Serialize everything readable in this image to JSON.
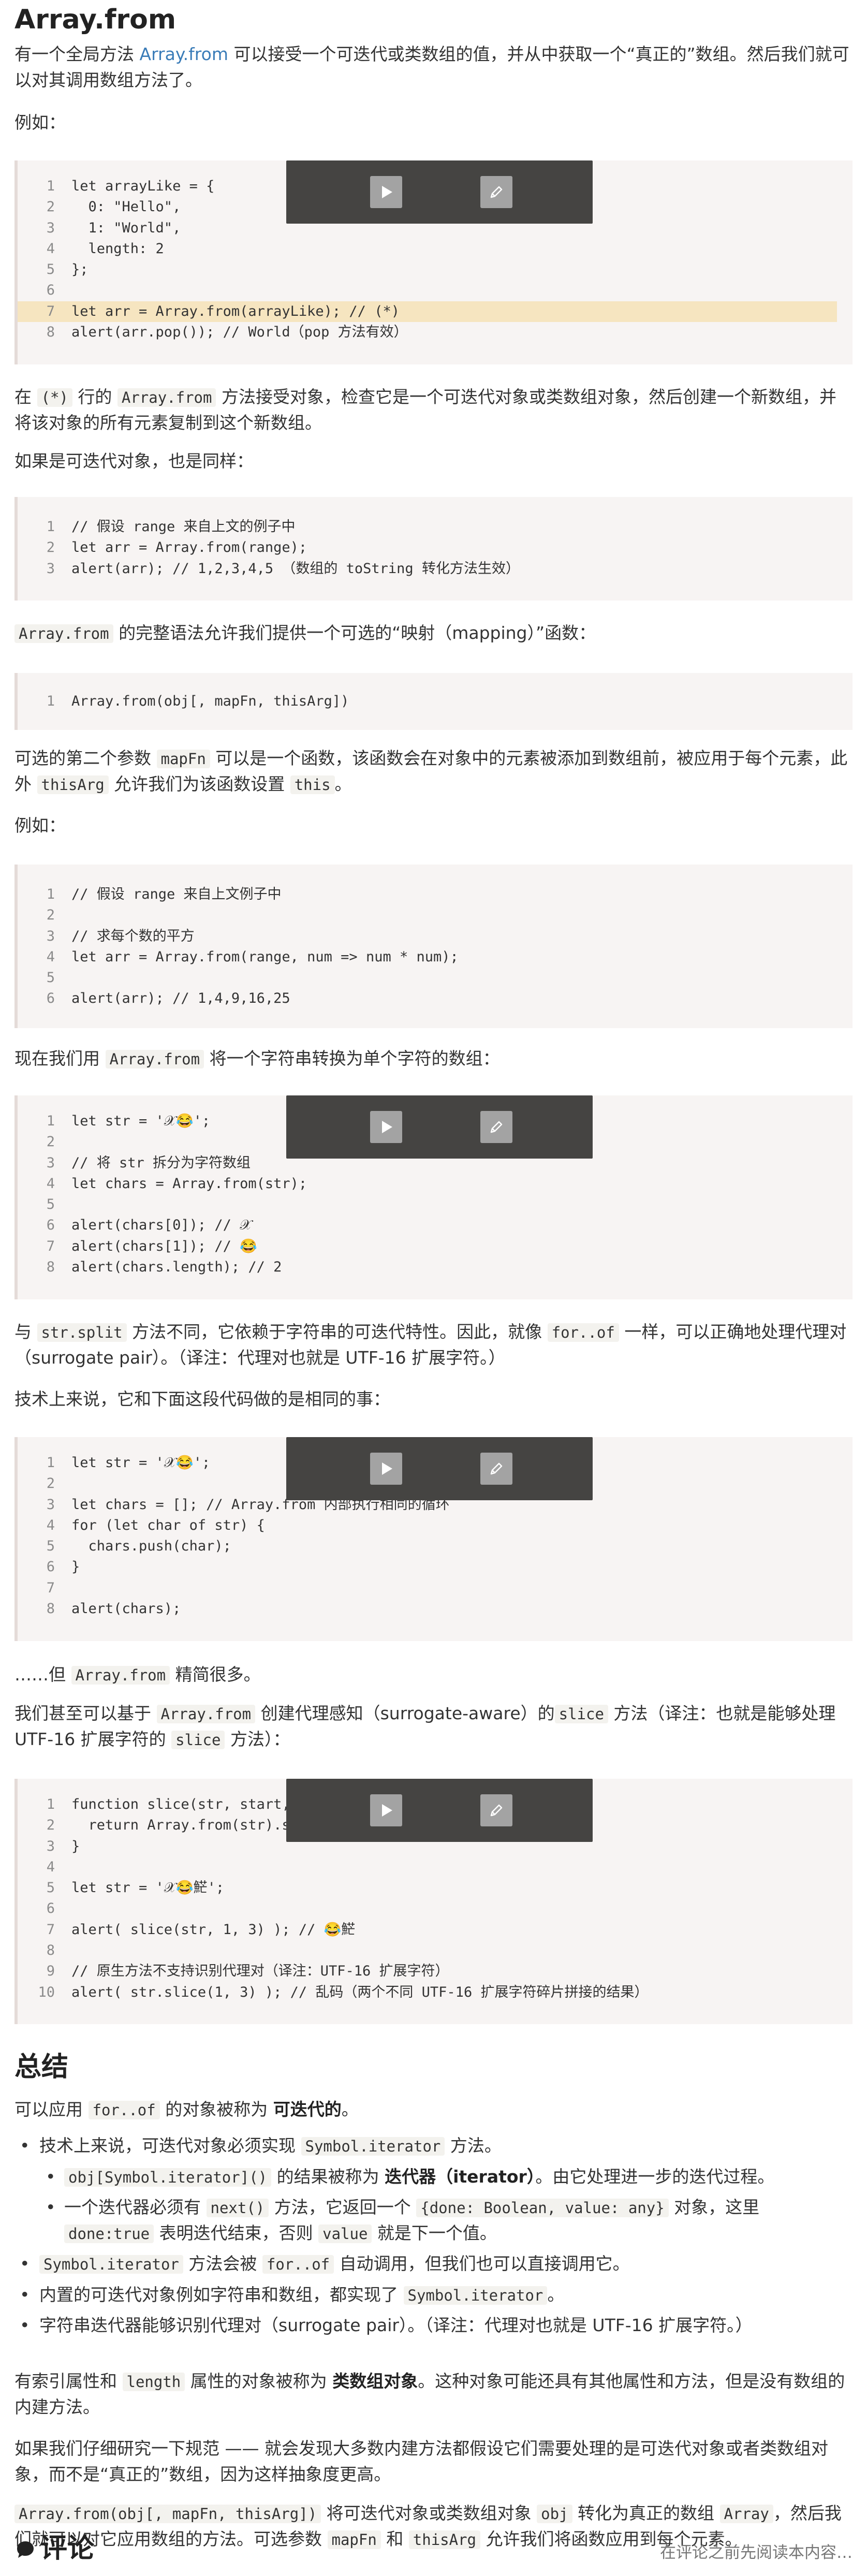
{
  "title": "Array.from",
  "intro": {
    "p1_a": "有一个全局方法 ",
    "p1_link": "Array.from",
    "p1_b": " 可以接受一个可迭代或类数组的值，并从中获取一个“真正的”数组。然后我们就可以对其调用数组方法了。",
    "example_label": "例如："
  },
  "block1": [
    [
      "1",
      "let arrayLike = {"
    ],
    [
      "2",
      "  0: \"Hello\","
    ],
    [
      "3",
      "  1: \"World\","
    ],
    [
      "4",
      "  length: 2"
    ],
    [
      "5",
      "};"
    ],
    [
      "6",
      ""
    ],
    [
      "7",
      "let arr = Array.from(arrayLike); // (*)"
    ],
    [
      "8",
      "alert(arr.pop()); // World（pop 方法有效）"
    ]
  ],
  "para2": {
    "a": "在 ",
    "code1": "(*)",
    "b": " 行的 ",
    "code2": "Array.from",
    "c": " 方法接受对象，检查它是一个可迭代对象或类数组对象，然后创建一个新数组，并将该对象的所有元素复制到这个新数组。"
  },
  "para3": "如果是可迭代对象，也是同样：",
  "block2": [
    [
      "1",
      "// 假设 range 来自上文的例子中"
    ],
    [
      "2",
      "let arr = Array.from(range);"
    ],
    [
      "3",
      "alert(arr); // 1,2,3,4,5 （数组的 toString 转化方法生效）"
    ]
  ],
  "para4": {
    "code": "Array.from",
    "text": " 的完整语法允许我们提供一个可选的“映射（mapping）”函数："
  },
  "block3": [
    [
      "1",
      "Array.from(obj[, mapFn, thisArg])"
    ]
  ],
  "para5": {
    "a": "可选的第二个参数 ",
    "code1": "mapFn",
    "b": " 可以是一个函数，该函数会在对象中的元素被添加到数组前，被应用于每个元素，此外 ",
    "code2": "thisArg",
    "c": " 允许我们为该函数设置 ",
    "code3": "this",
    "d": "。"
  },
  "para6": "例如：",
  "block4": [
    [
      "1",
      "// 假设 range 来自上文例子中"
    ],
    [
      "2",
      ""
    ],
    [
      "3",
      "// 求每个数的平方"
    ],
    [
      "4",
      "let arr = Array.from(range, num => num * num);"
    ],
    [
      "5",
      ""
    ],
    [
      "6",
      "alert(arr); // 1,4,9,16,25"
    ]
  ],
  "para7": {
    "a": "现在我们用 ",
    "code": "Array.from",
    "b": " 将一个字符串转换为单个字符的数组："
  },
  "block5": [
    [
      "1",
      "let str = '𝒳😂';"
    ],
    [
      "2",
      ""
    ],
    [
      "3",
      "// 将 str 拆分为字符数组"
    ],
    [
      "4",
      "let chars = Array.from(str);"
    ],
    [
      "5",
      ""
    ],
    [
      "6",
      "alert(chars[0]); // 𝒳"
    ],
    [
      "7",
      "alert(chars[1]); // 😂"
    ],
    [
      "8",
      "alert(chars.length); // 2"
    ]
  ],
  "para8": {
    "a": "与 ",
    "code1": "str.split",
    "b": " 方法不同，它依赖于字符串的可迭代特性。因此，就像 ",
    "code2": "for..of",
    "c": " 一样，可以正确地处理代理对（surrogate pair）。（译注：代理对也就是 UTF-16 扩展字符。）"
  },
  "para9": "技术上来说，它和下面这段代码做的是相同的事：",
  "block6": [
    [
      "1",
      "let str = '𝒳😂';"
    ],
    [
      "2",
      ""
    ],
    [
      "3",
      "let chars = []; // Array.from 内部执行相同的循环"
    ],
    [
      "4",
      "for (let char of str) {"
    ],
    [
      "5",
      "  chars.push(char);"
    ],
    [
      "6",
      "}"
    ],
    [
      "7",
      ""
    ],
    [
      "8",
      "alert(chars);"
    ]
  ],
  "para10": {
    "a": "……但 ",
    "code": "Array.from",
    "b": " 精简很多。"
  },
  "para11": {
    "a": "我们甚至可以基于 ",
    "code1": "Array.from",
    "b": " 创建代理感知（surrogate-aware）的",
    "code2": "slice",
    "c": " 方法（译注：也就是能够处理 UTF-16 扩展字符的 ",
    "code3": "slice",
    "d": " 方法）："
  },
  "block7": [
    [
      "1",
      "function slice(str, start, end) {"
    ],
    [
      "2",
      "  return Array.from(str).slice(start, end).join('');"
    ],
    [
      "3",
      "}"
    ],
    [
      "4",
      ""
    ],
    [
      "5",
      "let str = '𝒳😂𩷶';"
    ],
    [
      "6",
      ""
    ],
    [
      "7",
      "alert( slice(str, 1, 3) ); // 😂𩷶"
    ],
    [
      "8",
      ""
    ],
    [
      "9",
      "// 原生方法不支持识别代理对（译注：UTF-16 扩展字符）"
    ],
    [
      "10",
      "alert( str.slice(1, 3) ); // 乱码（两个不同 UTF-16 扩展字符碎片拼接的结果）"
    ]
  ],
  "summary": {
    "title": "总结",
    "p1_a": "可以应用 ",
    "p1_code": "for..of",
    "p1_b": " 的对象被称为 ",
    "p1_bold": "可迭代的",
    "p1_c": "。",
    "b1_a": "技术上来说，可迭代对象必须实现 ",
    "b1_code": "Symbol.iterator",
    "b1_b": " 方法。",
    "b1_1_code": "obj[Symbol.iterator]()",
    "b1_1_a": " 的结果被称为 ",
    "b1_1_bold": "迭代器（iterator）",
    "b1_1_b": "。由它处理进一步的迭代过程。",
    "b1_2_a": "一个迭代器必须有 ",
    "b1_2_code1": "next()",
    "b1_2_b": " 方法，它返回一个 ",
    "b1_2_code2": "{done: Boolean, value: any}",
    "b1_2_c": " 对象，这里 ",
    "b1_2_code3": "done:true",
    "b1_2_d": " 表明迭代结束，否则 ",
    "b1_2_code4": "value",
    "b1_2_e": " 就是下一个值。",
    "b2_code1": "Symbol.iterator",
    "b2_a": " 方法会被 ",
    "b2_code2": "for..of",
    "b2_b": " 自动调用，但我们也可以直接调用它。",
    "b3_a": "内置的可迭代对象例如字符串和数组，都实现了 ",
    "b3_code": "Symbol.iterator",
    "b3_b": "。",
    "b4": "字符串迭代器能够识别代理对（surrogate pair）。（译注：代理对也就是 UTF-16 扩展字符。）",
    "p2_a": "有索引属性和 ",
    "p2_code": "length",
    "p2_b": " 属性的对象被称为 ",
    "p2_bold": "类数组对象",
    "p2_c": "。这种对象可能还具有其他属性和方法，但是没有数组的内建方法。",
    "p3": "如果我们仔细研究一下规范 —— 就会发现大多数内建方法都假设它们需要处理的是可迭代对象或者类数组对象，而不是“真正的”数组，因为这样抽象度更高。",
    "p4_code1": "Array.from(obj[, mapFn, thisArg])",
    "p4_a": " 将可迭代对象或类数组对象 ",
    "p4_code2": "obj",
    "p4_b": " 转化为真正的数组 ",
    "p4_code3": "Array",
    "p4_c": "，然后我们就可以对它应用数组的方法。可选参数 ",
    "p4_code4": "mapFn",
    "p4_d": " 和 ",
    "p4_code5": "thisArg",
    "p4_e": " 允许我们将函数应用到每个元素。"
  },
  "comments": {
    "title": "评论",
    "note": "在评论之前先阅读本内容…"
  },
  "icons": {
    "run": "play-icon",
    "edit": "pencil-icon",
    "comments": "chat-bubble-icon"
  }
}
